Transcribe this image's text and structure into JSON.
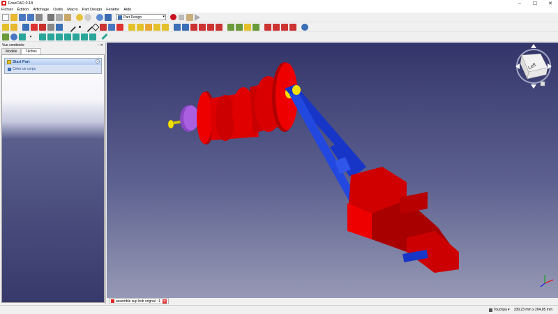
{
  "window": {
    "title": "FreeCAD 0.18",
    "controls": [
      "–",
      "☐",
      "✕"
    ]
  },
  "menu": [
    "Fichier",
    "Édition",
    "Affichage",
    "Outils",
    "Macro",
    "Part Design",
    "Fenêtre",
    "Aide"
  ],
  "toolbar": {
    "workbench": "Part Design"
  },
  "combo_view": {
    "title": "Vue combinée",
    "header_icons": "▫ ✕",
    "tabs": [
      "Modèle",
      "Tâches"
    ],
    "start_part": {
      "title": "Start Part",
      "collapse": "^",
      "action": "Créer un corps"
    }
  },
  "nav_cube": {
    "face": "Left"
  },
  "document_tab": {
    "label": "assemble sup bob orignal : 1",
    "close": "✕"
  },
  "status_bar": {
    "nav_style": "Touchpa ▾",
    "dimensions": "339,23 mm x 204,05 mm"
  },
  "colors": {
    "part_red": "#ee0000",
    "part_blue": "#1736c8",
    "part_purple": "#a05ad6",
    "bolt_yellow": "#f4e000"
  }
}
